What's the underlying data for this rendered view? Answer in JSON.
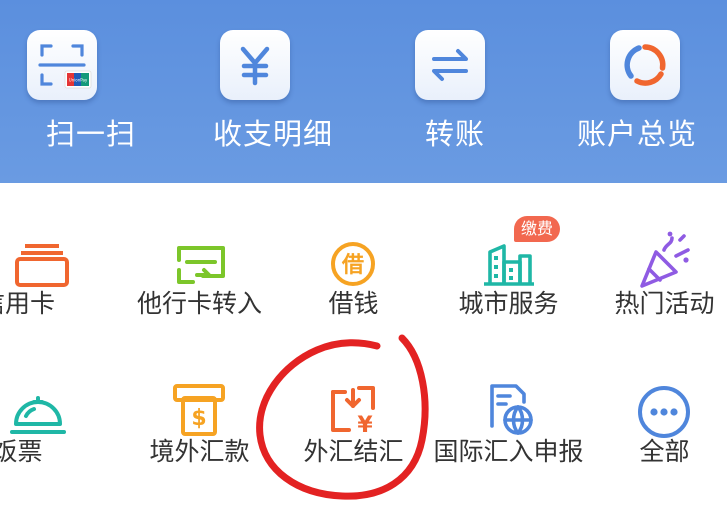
{
  "top_actions": [
    {
      "label": "扫一扫",
      "icon": "scan-icon"
    },
    {
      "label": "收支明细",
      "icon": "yuan-icon"
    },
    {
      "label": "转账",
      "icon": "transfer-arrows-icon"
    },
    {
      "label": "账户总览",
      "icon": "donut-chart-icon"
    }
  ],
  "scan_card_text": "UnionPay",
  "services": [
    {
      "label": "信用卡",
      "icon": "credit-card-stack-icon"
    },
    {
      "label": "他行卡转入",
      "icon": "card-transfer-in-icon"
    },
    {
      "label": "借钱",
      "icon": "borrow-coin-icon",
      "icon_text": "借"
    },
    {
      "label": "城市服务",
      "icon": "city-buildings-icon",
      "badge": "缴费"
    },
    {
      "label": "热门活动",
      "icon": "party-popper-icon"
    },
    {
      "label": "饭票",
      "icon": "meal-cloche-icon"
    },
    {
      "label": "境外汇款",
      "icon": "atm-dollar-icon",
      "icon_text": "$"
    },
    {
      "label": "外汇结汇",
      "icon": "forex-exchange-icon",
      "icon_text": "¥"
    },
    {
      "label": "国际汇入申报",
      "icon": "globe-document-icon"
    },
    {
      "label": "全部",
      "icon": "more-dots-icon"
    }
  ],
  "colors": {
    "header_blue": "#5b8fde",
    "icon_blue": "#4f86dc",
    "orange": "#f0662f",
    "green": "#7cc62a",
    "amber": "#f6a323",
    "teal": "#1fb7a6",
    "purple": "#8f5be3",
    "badge_red": "#f2684f",
    "annotation_red": "#e32222"
  },
  "annotation": {
    "shape": "hand-drawn-circle",
    "target": "外汇结汇"
  }
}
